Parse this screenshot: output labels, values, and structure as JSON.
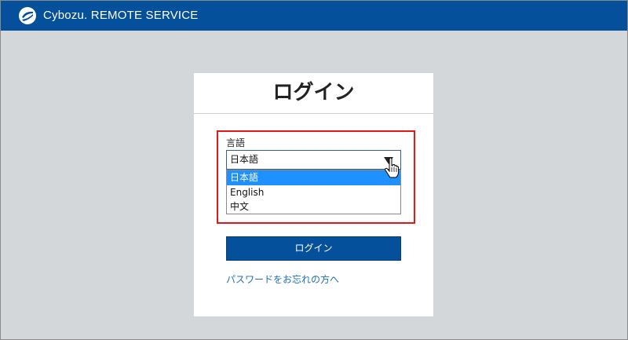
{
  "header": {
    "brand": "Cybozu. REMOTE SERVICE",
    "logo_icon": "cybozu-logo-icon",
    "background": "#05509a"
  },
  "login_card": {
    "title": "ログイン",
    "language_label": "言語",
    "language_select": {
      "selected": "日本語",
      "options": [
        "日本語",
        "English",
        "中文"
      ]
    },
    "login_button": "ログイン",
    "forgot_password_link": "パスワードをお忘れの方へ"
  },
  "colors": {
    "accent": "#05509a",
    "highlight_border": "#e01818",
    "selected_option": "#1e90ff",
    "link": "#1b6fbf"
  }
}
